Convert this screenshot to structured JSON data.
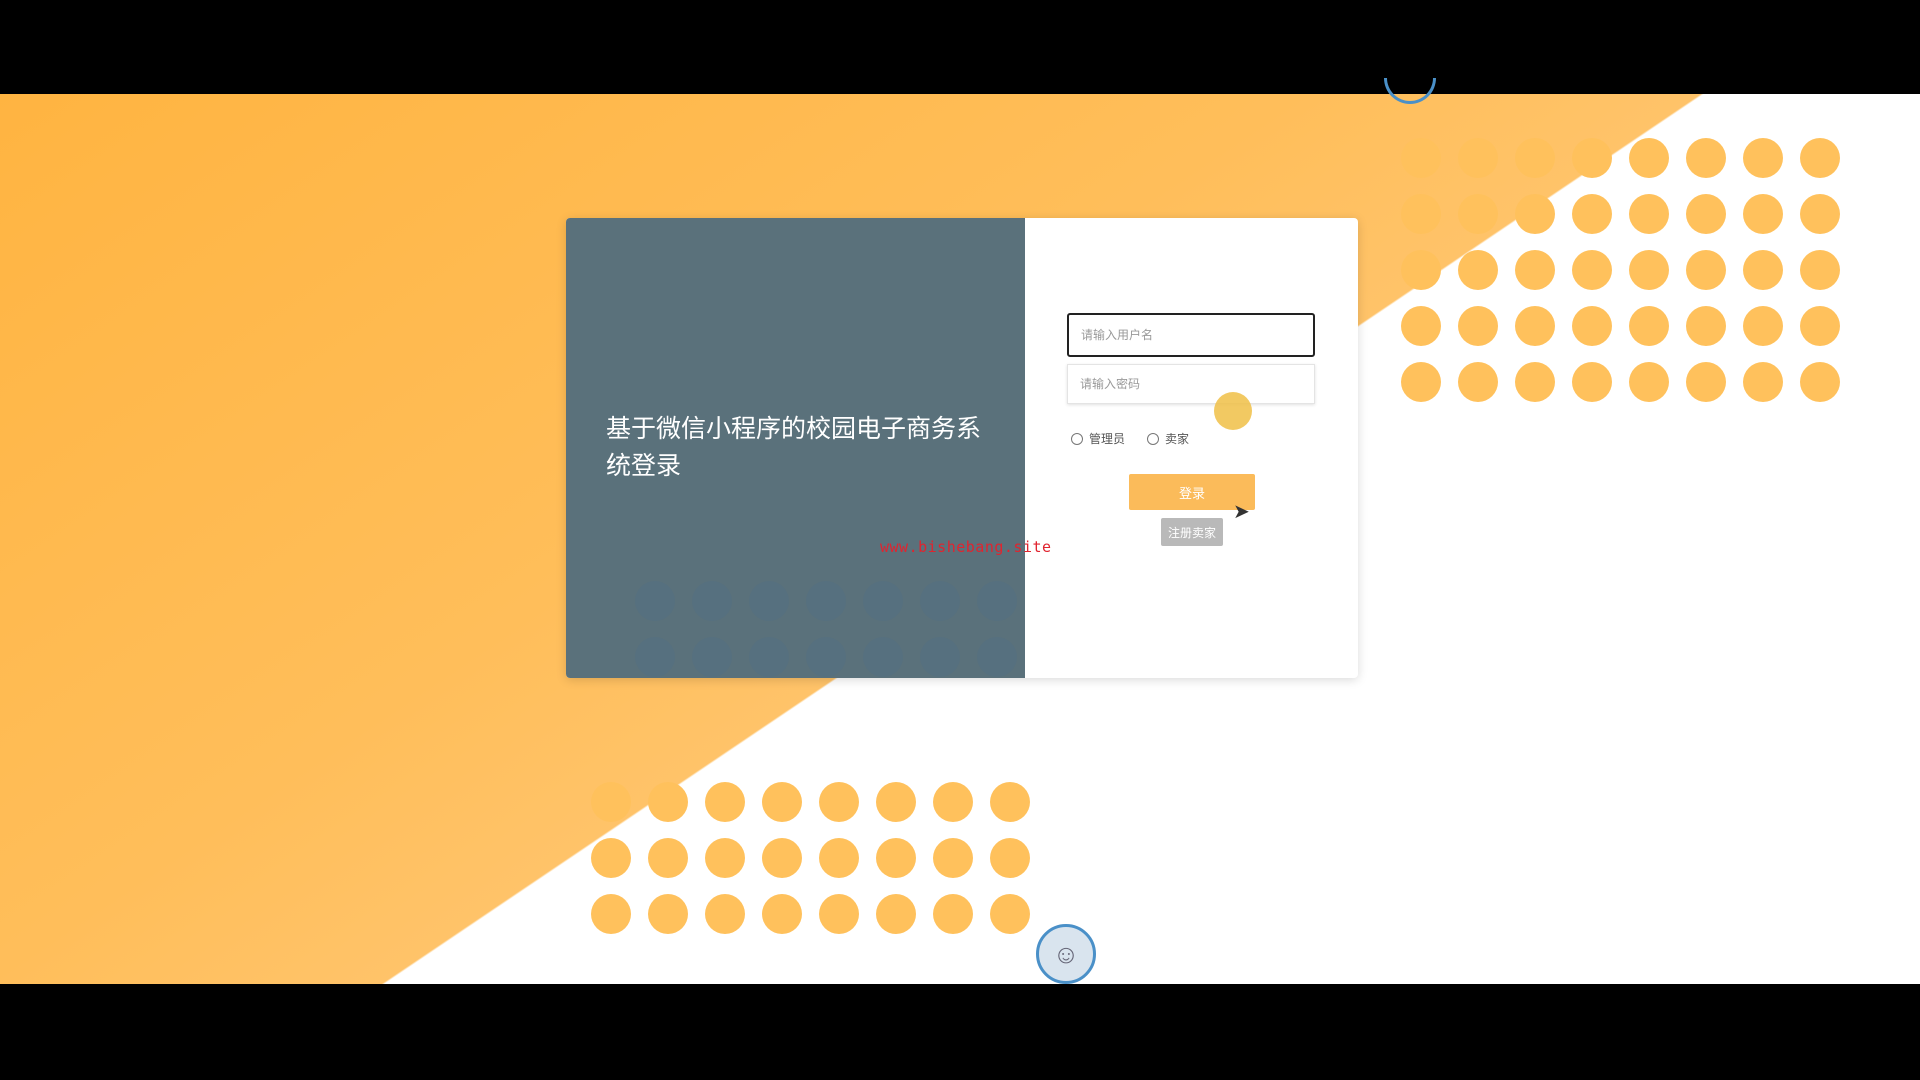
{
  "login": {
    "title": "基于微信小程序的校园电子商务系统登录",
    "username_placeholder": "请输入用户名",
    "password_placeholder": "请输入密码",
    "roles": [
      "管理员",
      "卖家"
    ],
    "login_label": "登录",
    "register_label": "注册卖家"
  },
  "watermark": "www.bishebang.site",
  "colors": {
    "accent": "#fbbb5a",
    "panel": "#5a717b",
    "register_button": "#b9b9b9",
    "background_orange": "#ffbe5a",
    "watermark": "#e0242f"
  },
  "icons": {
    "cursor": "mouse-pointer-icon",
    "avatar": "robot-avatar-icon"
  }
}
